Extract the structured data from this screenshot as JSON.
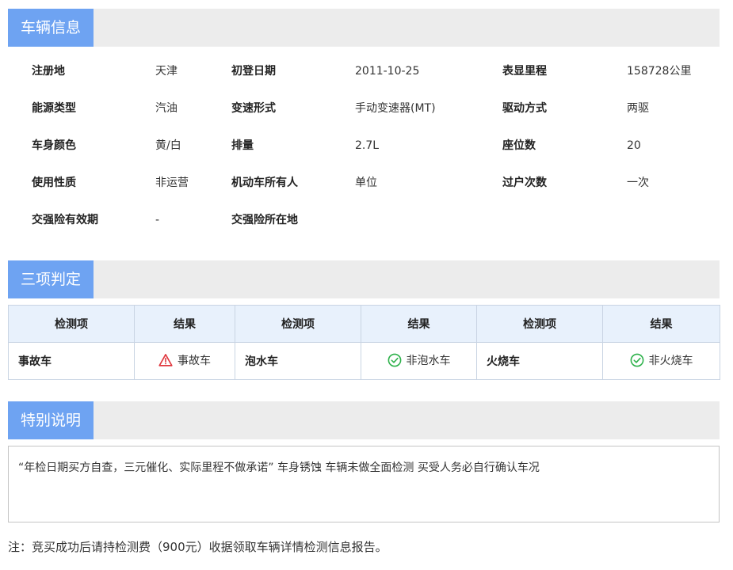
{
  "sections": {
    "vehicle_info": "车辆信息",
    "judgement": "三项判定",
    "special_note": "特别说明"
  },
  "vehicle_info": {
    "rows": [
      [
        {
          "label": "注册地",
          "value": "天津"
        },
        {
          "label": "初登日期",
          "value": "2011-10-25"
        },
        {
          "label": "表显里程",
          "value": "158728公里"
        }
      ],
      [
        {
          "label": "能源类型",
          "value": "汽油"
        },
        {
          "label": "变速形式",
          "value": "手动变速器(MT)"
        },
        {
          "label": "驱动方式",
          "value": "两驱"
        }
      ],
      [
        {
          "label": "车身颜色",
          "value": "黄/白"
        },
        {
          "label": "排量",
          "value": "2.7L"
        },
        {
          "label": "座位数",
          "value": "20"
        }
      ],
      [
        {
          "label": "使用性质",
          "value": "非运营"
        },
        {
          "label": "机动车所有人",
          "value": "单位"
        },
        {
          "label": "过户次数",
          "value": "一次"
        }
      ],
      [
        {
          "label": "交强险有效期",
          "value": "-"
        },
        {
          "label": "交强险所在地",
          "value": ""
        }
      ]
    ]
  },
  "judgement": {
    "headers": [
      "检测项",
      "结果",
      "检测项",
      "结果",
      "检测项",
      "结果"
    ],
    "items": [
      {
        "name": "事故车",
        "result": "事故车",
        "status": "warning",
        "icon": "warning-triangle-icon",
        "color": "#e0363d"
      },
      {
        "name": "泡水车",
        "result": "非泡水车",
        "status": "ok",
        "icon": "check-circle-icon",
        "color": "#2fb24c"
      },
      {
        "name": "火烧车",
        "result": "非火烧车",
        "status": "ok",
        "icon": "check-circle-icon",
        "color": "#2fb24c"
      }
    ]
  },
  "special_note": {
    "text": "“年检日期买方自查，三元催化、实际里程不做承诺” 车身锈蚀 车辆未做全面检测 买受人务必自行确认车况"
  },
  "footnote": "注：竞买成功后请持检测费（900元）收据领取车辆详情检测信息报告。",
  "colors": {
    "accent": "#6ea3f2",
    "header_bg": "#ececec",
    "table_header_bg": "#e8f1fc",
    "warning": "#e0363d",
    "ok": "#2fb24c"
  }
}
